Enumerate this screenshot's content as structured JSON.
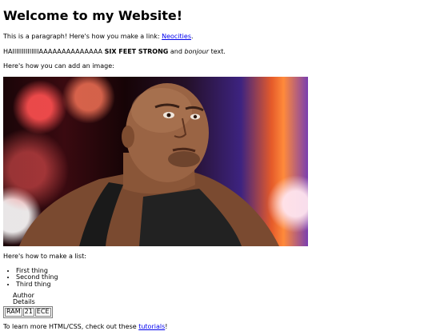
{
  "heading": "Welcome to my Website!",
  "intro": {
    "text_before": "This is a paragraph! Here's how you make a link: ",
    "link": "Neocities",
    "text_after": "."
  },
  "styles_line": {
    "plain": "HAIIIIIIIIIIIIIIAAAAAAAAAAAAAA ",
    "bold": "SIX FEET STRONG",
    "middle": " and ",
    "italic": "bonjour",
    "end": " text."
  },
  "image_caption": "Here's how you can add an image:",
  "list_caption": "Here's how to make a list:",
  "list_items": [
    "First thing",
    "Second thing",
    "Third thing"
  ],
  "details": {
    "line1": "Author",
    "line2": "Details"
  },
  "table_cells": [
    "RAM",
    "21",
    "ECE"
  ],
  "outro": {
    "text_before": "To learn more HTML/CSS, check out these ",
    "link": "tutorials",
    "text_after": "!"
  }
}
